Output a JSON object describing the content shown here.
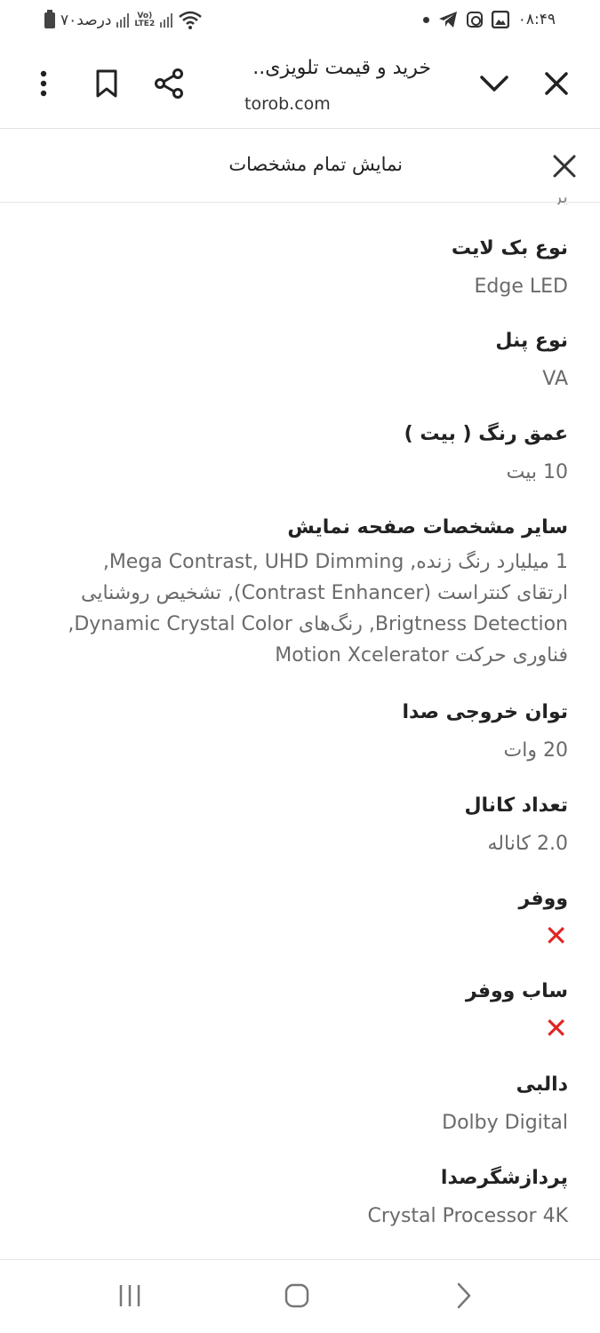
{
  "status_bar": {
    "time": "۰۸:۴۹",
    "battery_text": "۷۰درصد",
    "lte_label_top": "Vo)",
    "lte_label_bottom": "LTE2"
  },
  "browser": {
    "title": "خرید و قیمت تلویزی..",
    "url": "torob.com"
  },
  "sheet": {
    "title": "نمایش تمام مشخصات",
    "cut_text": "یر"
  },
  "specs": [
    {
      "label": "نوع بک لایت",
      "value": "Edge LED"
    },
    {
      "label": "نوع پنل",
      "value": "VA"
    },
    {
      "label": "عمق رنگ ( بیت )",
      "value": "10 بیت"
    },
    {
      "label": "سایر مشخصات صفحه نمایش",
      "lines": [
        "1 میلیارد رنگ زنده, Mega Contrast, UHD Dimming,",
        "ارتقای کنتراست (Contrast Enhancer), تشخیص روشنایی",
        "Brigtness Detection, رنگ‌های Dynamic Crystal Color,",
        "فناوری حرکت Motion Xcelerator"
      ]
    },
    {
      "label": "توان خروجی صدا",
      "value": "20 وات"
    },
    {
      "label": "تعداد کانال",
      "value": "2.0 کاناله"
    },
    {
      "label": "ووفر",
      "icon": "cross-mark-icon",
      "icon_color": "#e02424"
    },
    {
      "label": "ساب ووفر",
      "icon": "cross-mark-icon",
      "icon_color": "#e02424"
    },
    {
      "label": "دالبی",
      "value": "Dolby Digital"
    },
    {
      "label": "پردازشگرصدا",
      "value": "Crystal Processor 4K"
    }
  ]
}
